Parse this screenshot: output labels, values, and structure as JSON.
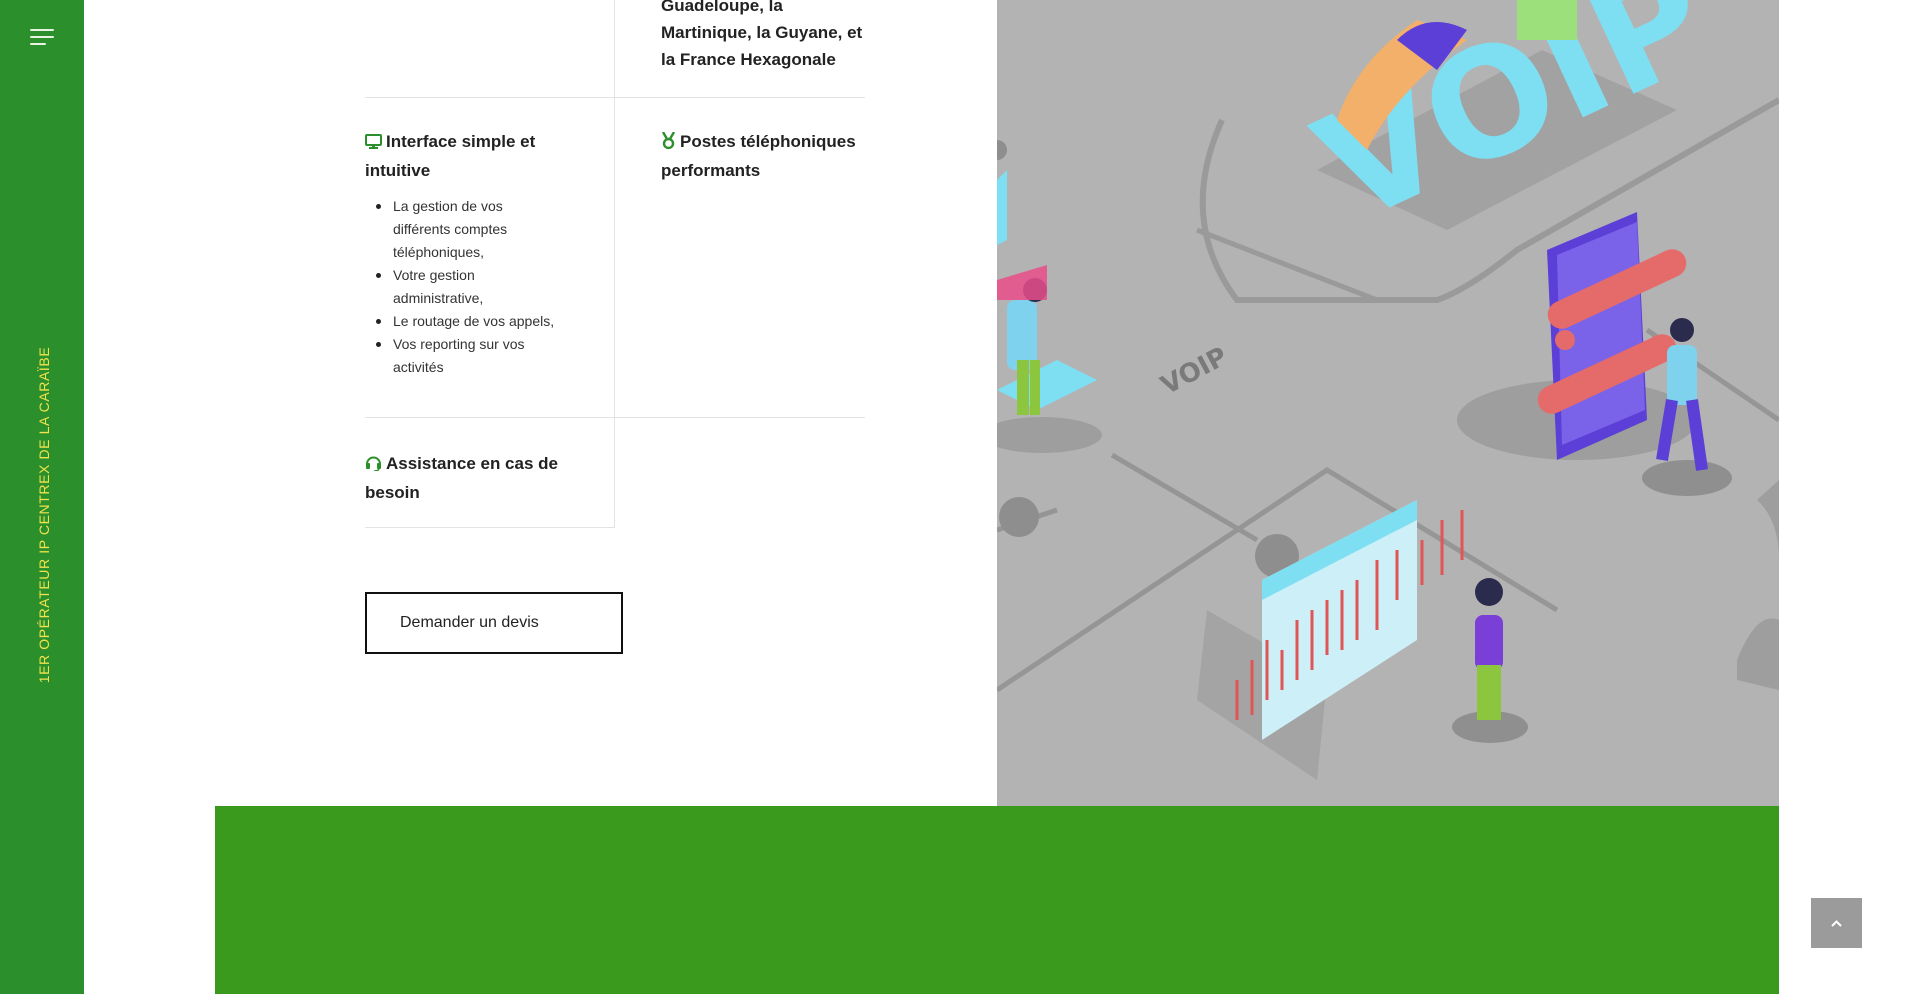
{
  "rail": {
    "menu_icon": "hamburger-menu-icon",
    "tagline": "1ER OPÉRATEUR IP CENTREX DE LA CARAÏBE",
    "tagline_color": "#f2e24b",
    "background": "#2b8f2b"
  },
  "features": {
    "top_right_text": "Guadeloupe, la Martinique, la Guyane, et la France Hexagonale",
    "interface": {
      "icon": "monitor-icon",
      "title": "Interface simple et intuitive",
      "bullets": [
        "La gestion de vos différents comptes téléphoniques,",
        "Votre gestion administrative,",
        "Le routage de vos appels,",
        "Vos reporting sur vos activités"
      ]
    },
    "phones": {
      "icon": "medal-icon",
      "title": "Postes téléphoniques performants"
    },
    "support": {
      "icon": "headset-icon",
      "title": "Assistance en cas de besoin"
    },
    "icon_color": "#2b8f2b"
  },
  "cta": {
    "label": "Demander un devis"
  },
  "illustration": {
    "label_voip_big": "VOIP",
    "label_voip_small": "VOIP"
  },
  "footer_band": {
    "color": "#3a9a1e"
  },
  "scroll_top": {
    "icon": "chevron-up-icon"
  }
}
